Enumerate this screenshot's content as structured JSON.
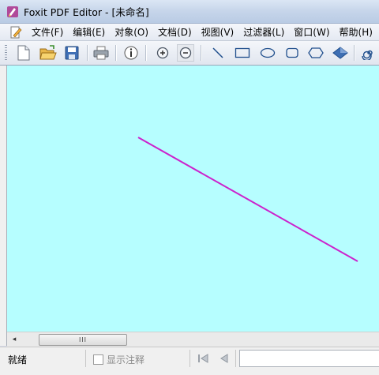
{
  "window": {
    "title": "Foxit PDF Editor - [未命名]"
  },
  "menu": {
    "items": [
      "文件(F)",
      "编辑(E)",
      "对象(O)",
      "文档(D)",
      "视图(V)",
      "过滤器(L)",
      "窗口(W)",
      "帮助(H)"
    ]
  },
  "toolbar": {
    "buttons": [
      "new-document",
      "open",
      "save",
      "print",
      "info",
      "zoom-in",
      "zoom-out",
      "line",
      "rectangle",
      "ellipse",
      "rounded-rectangle",
      "hexagon",
      "diamond",
      "spiral"
    ]
  },
  "canvas": {
    "background": "#b6feff",
    "line_color": "#cc22cc"
  },
  "scrollbar": {
    "thumb_grip": "III"
  },
  "statusbar": {
    "status_text": "就绪",
    "show_annotations_label": "显示注释",
    "show_annotations_checked": false
  }
}
